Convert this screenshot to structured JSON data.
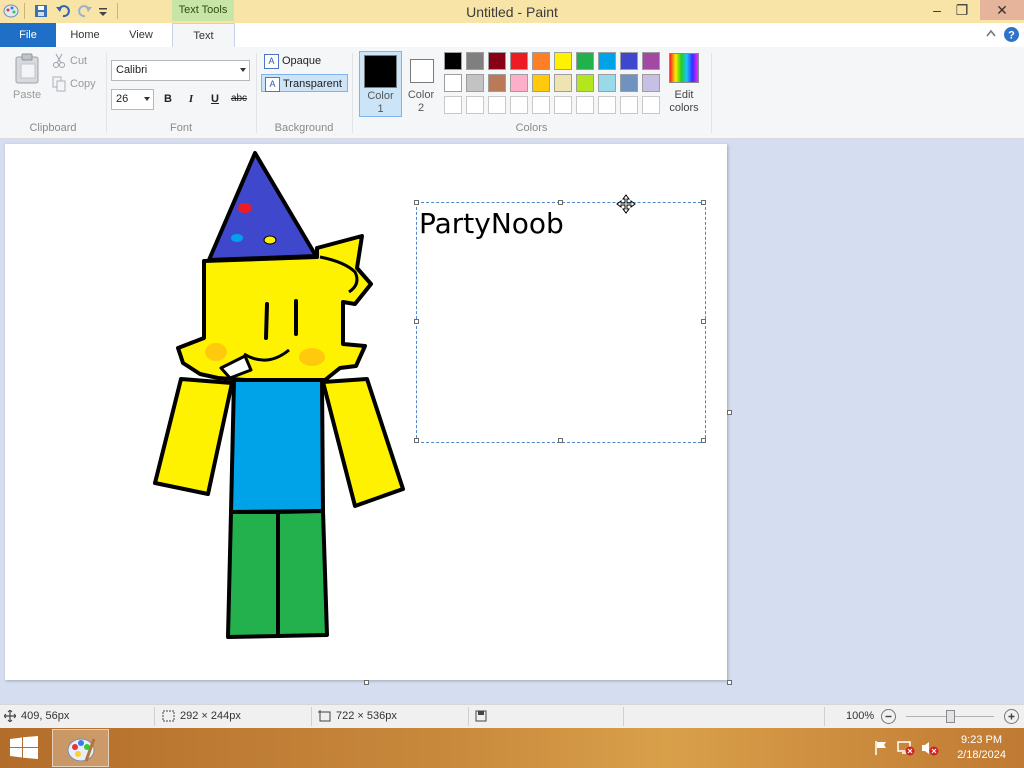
{
  "window": {
    "title": "Untitled - Paint",
    "context_tab": "Text Tools",
    "minimize_glyph": "–",
    "maximize_glyph": "❐",
    "close_glyph": "✕"
  },
  "tabs": [
    {
      "label": "File"
    },
    {
      "label": "Home"
    },
    {
      "label": "View"
    },
    {
      "label": "Text"
    }
  ],
  "help_glyphs": {
    "collapse": "^",
    "help": "?"
  },
  "ribbon": {
    "clipboard": {
      "paste": "Paste",
      "cut": "Cut",
      "copy": "Copy",
      "label": "Clipboard"
    },
    "font": {
      "family": "Calibri",
      "size": "26",
      "bold": "B",
      "italic": "I",
      "underline": "U",
      "strikethrough": "abc",
      "label": "Font"
    },
    "background": {
      "opaque": "Opaque",
      "transparent": "Transparent",
      "label": "Background"
    },
    "color1": {
      "line1": "Color",
      "line2": "1",
      "value": "#000000"
    },
    "color2": {
      "line1": "Color",
      "line2": "2",
      "value": "#ffffff"
    },
    "colors_label": "Colors",
    "edit_colors": {
      "line1": "Edit",
      "line2": "colors"
    },
    "palette_row1": [
      "#000000",
      "#7f7f7f",
      "#880015",
      "#ed1c24",
      "#ff7f27",
      "#fff200",
      "#22b14c",
      "#00a2e8",
      "#3f48cc",
      "#a349a4"
    ],
    "palette_row2": [
      "#ffffff",
      "#c3c3c3",
      "#b97a57",
      "#ffaec9",
      "#ffc90e",
      "#efe4b0",
      "#b5e61d",
      "#99d9ea",
      "#7092be",
      "#c8bfe7"
    ],
    "palette_row3": [
      "#ffffff",
      "#ffffff",
      "#ffffff",
      "#ffffff",
      "#ffffff",
      "#ffffff",
      "#ffffff",
      "#ffffff",
      "#ffffff",
      "#ffffff"
    ]
  },
  "canvas": {
    "text_box_content": "PartyNoob"
  },
  "status": {
    "cursor_pos": "409, 56px",
    "selection_size": "292 × 244px",
    "image_size": "722 × 536px",
    "zoom": "100%",
    "zoom_fraction": 0.5
  },
  "taskbar": {
    "time": "9:23 PM",
    "date": "2/18/2024"
  }
}
